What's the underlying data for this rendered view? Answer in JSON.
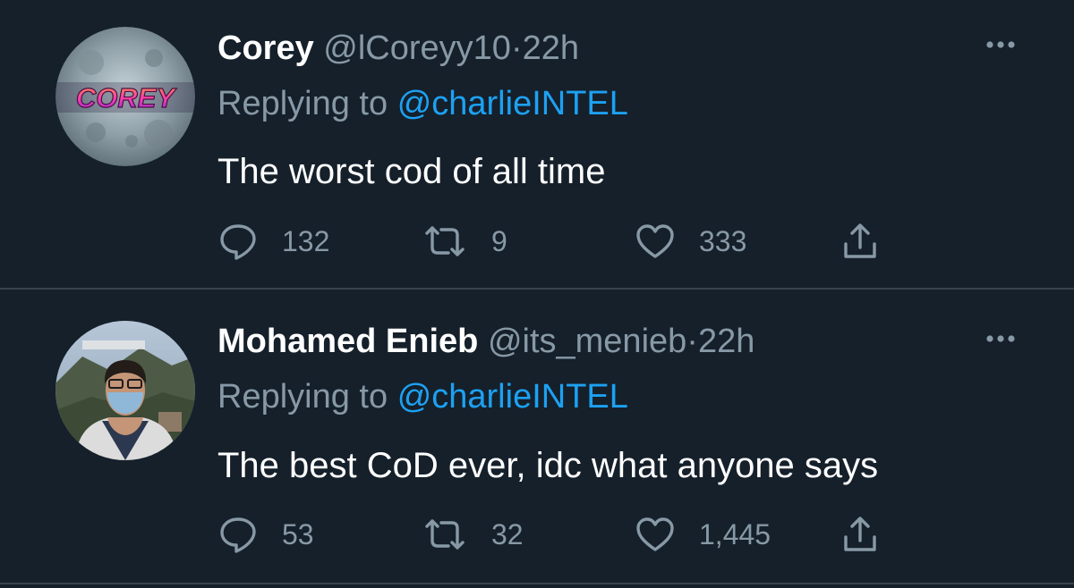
{
  "colors": {
    "background": "#15202b",
    "divider": "#38444d",
    "text_primary": "#ffffff",
    "text_secondary": "#8899a6",
    "accent": "#1da1f2"
  },
  "tweets": [
    {
      "display_name": "Corey",
      "handle": "@lCoreyy10",
      "separator": "·",
      "time": "22h",
      "replying_prefix": "Replying to",
      "replying_to": "@charlieINTEL",
      "text": "The worst cod of all time",
      "reply_count": "132",
      "retweet_count": "9",
      "like_count": "333",
      "avatar_text": "COREY",
      "avatar_icon": "corey-avatar-icon"
    },
    {
      "display_name": "Mohamed Enieb",
      "handle": "@its_menieb",
      "separator": "·",
      "time": "22h",
      "replying_prefix": "Replying to",
      "replying_to": "@charlieINTEL",
      "text": "The best CoD ever, idc what anyone says",
      "reply_count": "53",
      "retweet_count": "32",
      "like_count": "1,445",
      "avatar_icon": "person-photo-avatar-icon"
    }
  ],
  "icons": {
    "more": "more-options-icon",
    "reply": "reply-icon",
    "retweet": "retweet-icon",
    "like": "heart-icon",
    "share": "share-icon"
  }
}
